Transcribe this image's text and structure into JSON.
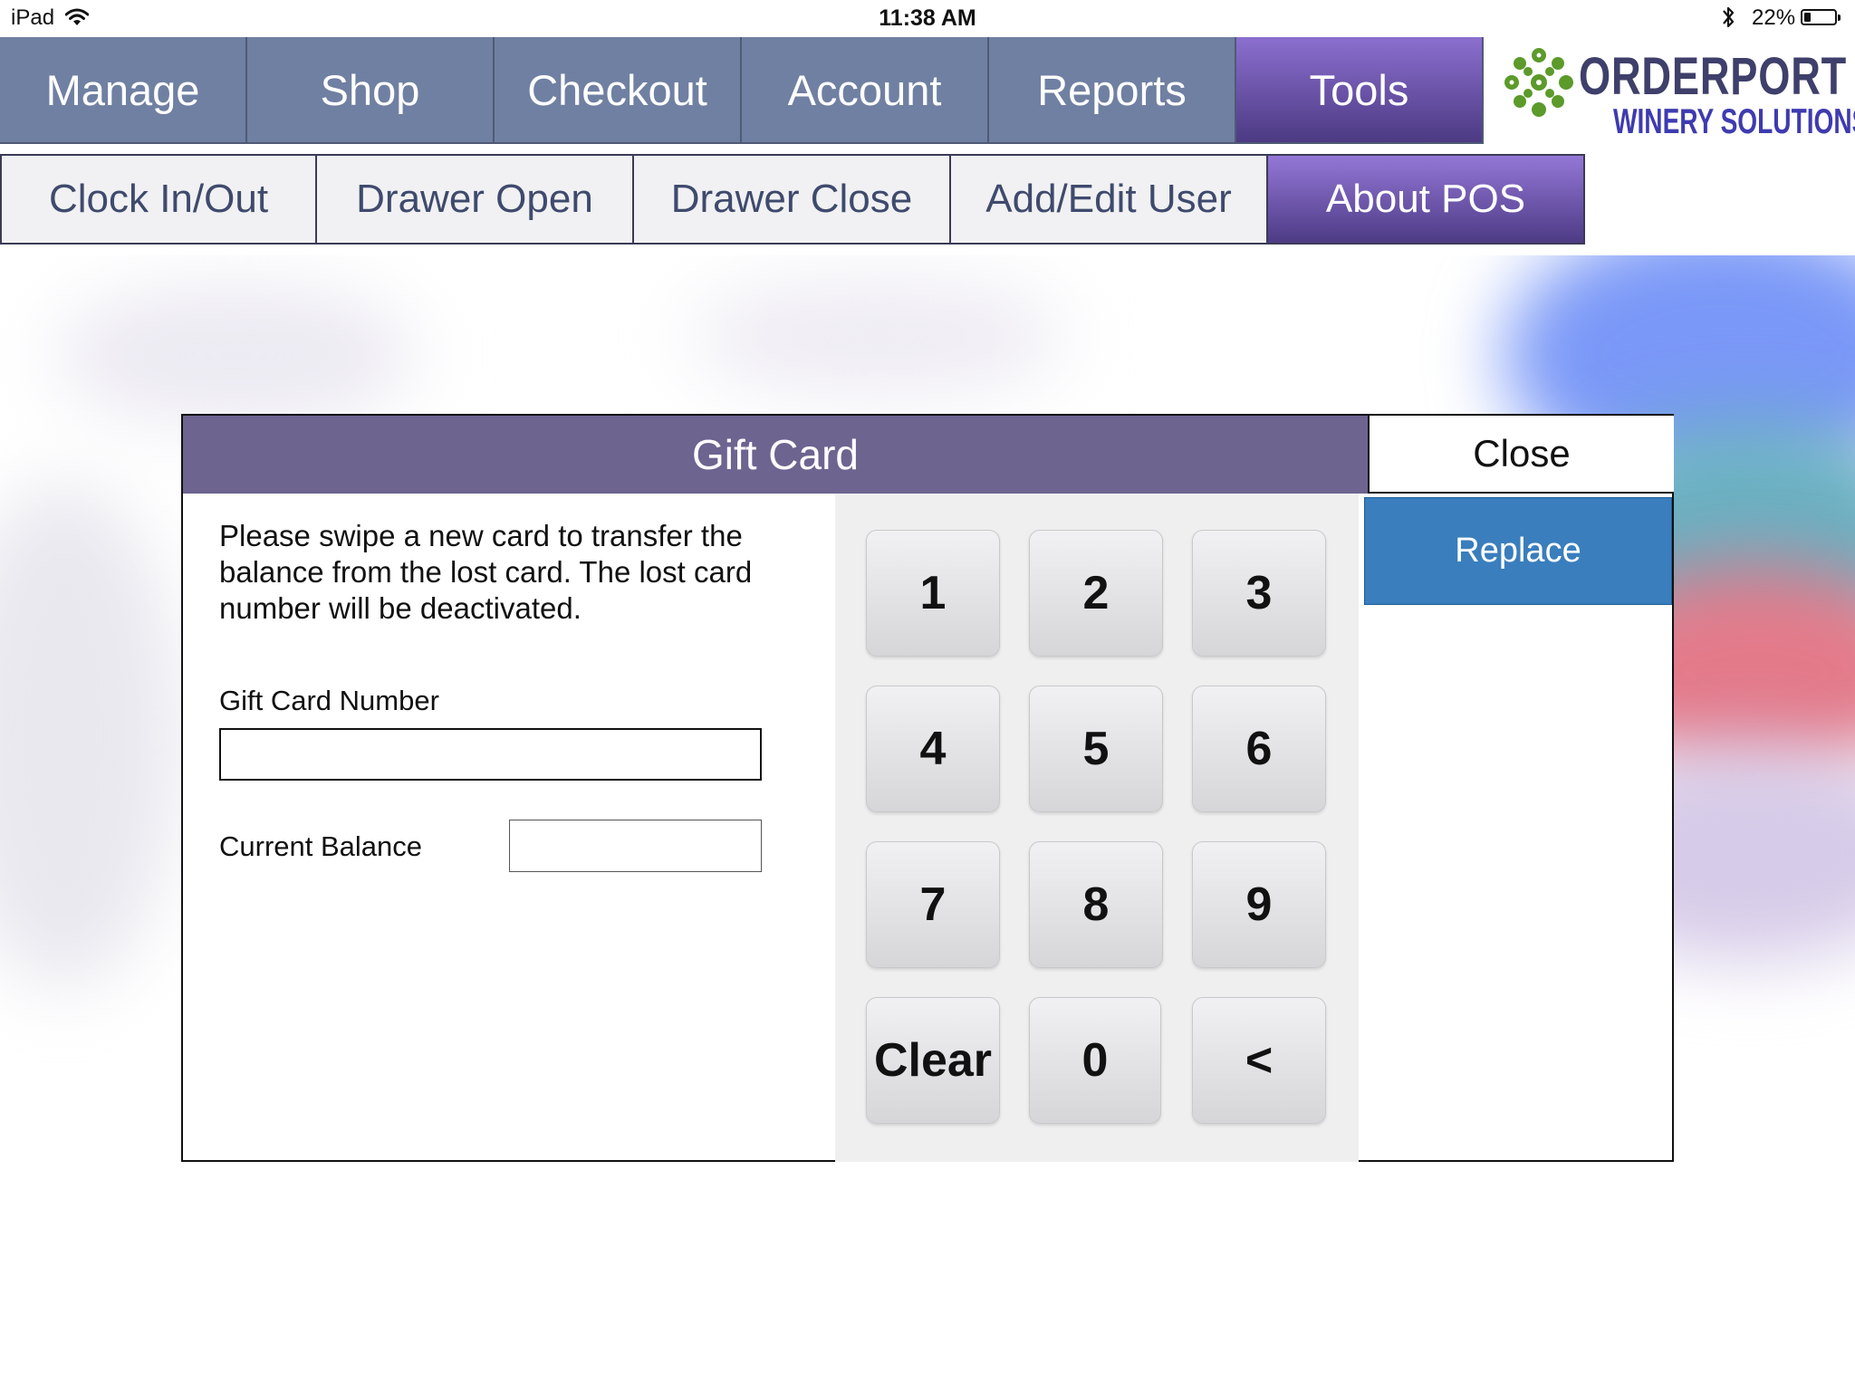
{
  "status_bar": {
    "device": "iPad",
    "time": "11:38 AM",
    "battery_percent": "22%",
    "battery_level": 0.22,
    "icons": [
      "wifi-icon",
      "bluetooth-icon",
      "battery-icon"
    ]
  },
  "main_nav": {
    "tabs": [
      {
        "label": "Manage",
        "active": false
      },
      {
        "label": "Shop",
        "active": false
      },
      {
        "label": "Checkout",
        "active": false
      },
      {
        "label": "Account",
        "active": false
      },
      {
        "label": "Reports",
        "active": false
      },
      {
        "label": "Tools",
        "active": true
      }
    ]
  },
  "brand": {
    "name_top": "ORDERPORT",
    "name_bottom": "WINERY SOLUTIONS",
    "icon": "grape-cluster-logo-icon"
  },
  "sub_nav": {
    "items": [
      {
        "label": "Clock In/Out",
        "active": false
      },
      {
        "label": "Drawer Open",
        "active": false
      },
      {
        "label": "Drawer Close",
        "active": false
      },
      {
        "label": "Add/Edit User",
        "active": false
      },
      {
        "label": "About POS",
        "active": true
      }
    ]
  },
  "modal": {
    "title": "Gift Card",
    "close_label": "Close",
    "replace_label": "Replace",
    "instructions": "Please swipe a new card to transfer the balance from the lost card. The lost card number will be deactivated.",
    "gift_card_number_label": "Gift Card Number",
    "gift_card_number_value": "",
    "current_balance_label": "Current Balance",
    "current_balance_value": "",
    "keypad": [
      "1",
      "2",
      "3",
      "4",
      "5",
      "6",
      "7",
      "8",
      "9",
      "Clear",
      "0",
      "<"
    ]
  },
  "colors": {
    "nav_tab": "#7080a2",
    "active_purple": "#5e4a9c",
    "modal_header": "#6d6490",
    "replace_blue": "#3a7ebd",
    "logo_green": "#5c9a2b",
    "logo_navy": "#3f3f6b"
  }
}
